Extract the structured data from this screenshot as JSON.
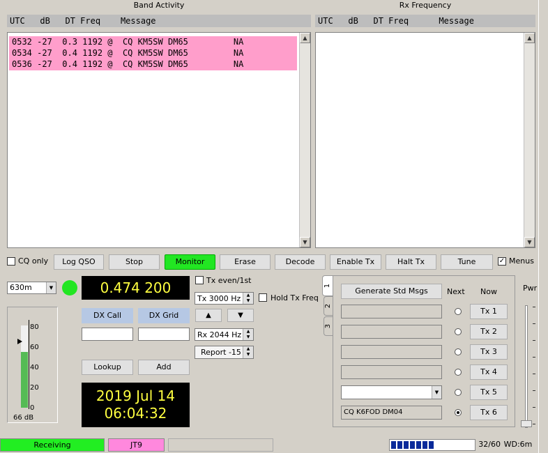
{
  "band_activity": {
    "title": "Band Activity",
    "header": "UTC   dB   DT Freq    Message",
    "rows": [
      "0532 -27  0.3 1192 @  CQ KM5SW DM65         NA",
      "0534 -27  0.4 1192 @  CQ KM5SW DM65         NA",
      "0536 -27  0.4 1192 @  CQ KM5SW DM65         NA"
    ],
    "highlight_color": "#ff9ecb"
  },
  "rx_frequency": {
    "title": "Rx Frequency",
    "header": "UTC   dB   DT Freq      Message"
  },
  "controls": {
    "cq_only": "CQ only",
    "log_qso": "Log QSO",
    "stop": "Stop",
    "monitor": "Monitor",
    "erase": "Erase",
    "decode": "Decode",
    "enable_tx": "Enable Tx",
    "halt_tx": "Halt Tx",
    "tune": "Tune",
    "menus": "Menus",
    "menus_checked": true
  },
  "left": {
    "band": "630m",
    "frequency": "0.474 200",
    "dx_call_label": "DX Call",
    "dx_grid_label": "DX Grid",
    "dx_call_value": "",
    "dx_grid_value": "",
    "lookup": "Lookup",
    "add": "Add",
    "date": "2019 Jul 14",
    "time": "06:04:32",
    "meter_ticks": [
      "80",
      "60",
      "40",
      "20",
      "0"
    ],
    "meter_db": "66 dB",
    "meter_level": 0.68
  },
  "mid": {
    "tx_even": "Tx even/1st",
    "tx_freq": "Tx  3000 Hz",
    "hold_tx_freq": "Hold Tx Freq",
    "rx_freq": "Rx  2044 Hz",
    "report": "Report -15",
    "up_arrow": "▲",
    "down_arrow": "▼"
  },
  "tx_panel": {
    "tabs": [
      "1",
      "2",
      "3"
    ],
    "generate": "Generate Std Msgs",
    "next_label": "Next",
    "now_label": "Now",
    "messages": [
      "",
      "",
      "",
      "",
      "",
      "CQ K6FOD DM04"
    ],
    "tx_buttons": [
      "Tx 1",
      "Tx 2",
      "Tx 3",
      "Tx 4",
      "Tx 5",
      "Tx 6"
    ],
    "selected_next": 6
  },
  "pwr": {
    "label": "Pwr"
  },
  "status": {
    "receiving": "Receiving",
    "mode": "JT9",
    "extra": "",
    "progress_text": "32/60",
    "progress_fraction": 0.53,
    "wd": "WD:6m"
  }
}
